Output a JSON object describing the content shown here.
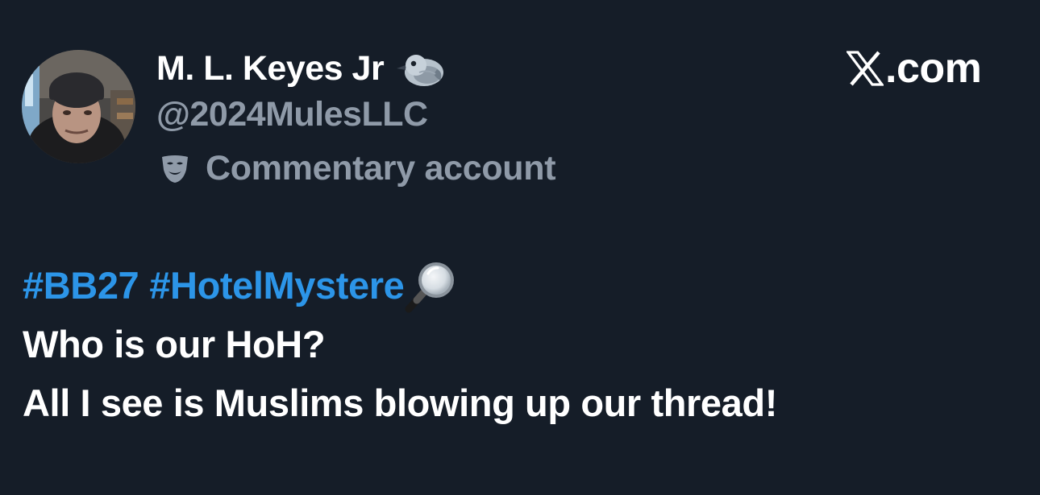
{
  "author": {
    "display_name": "M. L. Keyes Jr",
    "handle": "@2024MulesLLC",
    "account_label": "Commentary account",
    "name_badge_icon": "pigeon-icon",
    "label_icon": "performing-arts-mask-icon",
    "avatar_icon": "profile-photo-avatar"
  },
  "brand": {
    "logo_icon": "x-logo-icon",
    "text": ".com"
  },
  "tweet": {
    "hashtags": [
      "#BB27",
      "#HotelMystere"
    ],
    "hashtag_trailing_icon": "magnifying-glass-icon",
    "lines": [
      "Who is our HoH?",
      "All I see is Muslims blowing up our thread!"
    ]
  },
  "colors": {
    "background": "#151d28",
    "primary_text": "#ffffff",
    "secondary_text": "#8f9aa8",
    "hashtag": "#2c95e8"
  }
}
